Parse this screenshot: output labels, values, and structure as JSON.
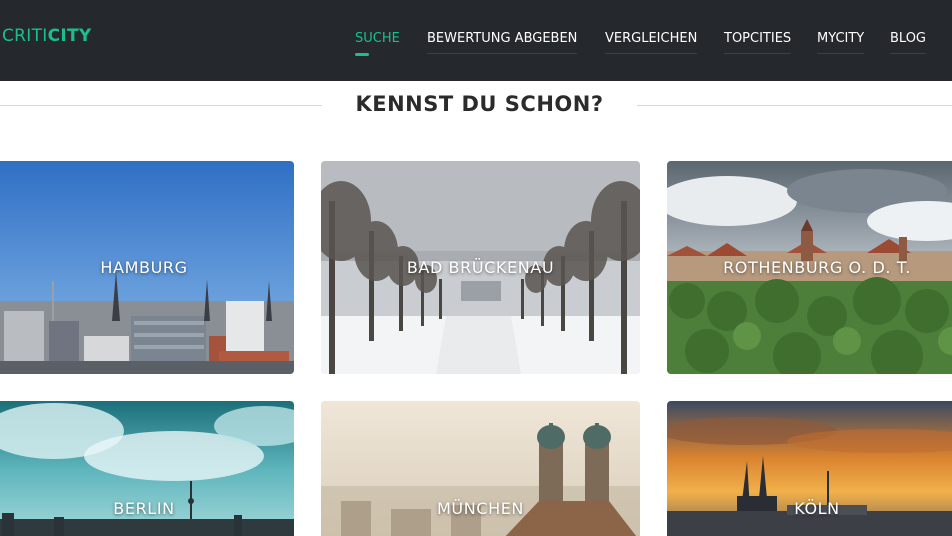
{
  "logo": {
    "part1": "CRITI",
    "part2": "CITY"
  },
  "nav": [
    {
      "label": "SUCHE",
      "active": true
    },
    {
      "label": "BEWERTUNG ABGEBEN",
      "active": false
    },
    {
      "label": "VERGLEICHEN",
      "active": false
    },
    {
      "label": "TOPCITIES",
      "active": false
    },
    {
      "label": "MYCITY",
      "active": false
    },
    {
      "label": "BLOG",
      "active": false
    }
  ],
  "section": {
    "title": "KENNST DU SCHON?"
  },
  "cities": [
    {
      "name": "HAMBURG"
    },
    {
      "name": "BAD BRÜCKENAU"
    },
    {
      "name": "ROTHENBURG O. D. T."
    },
    {
      "name": "BERLIN"
    },
    {
      "name": "MÜNCHEN"
    },
    {
      "name": "KÖLN"
    }
  ],
  "colors": {
    "accent": "#1bbf8e",
    "topbar": "#25282c"
  }
}
